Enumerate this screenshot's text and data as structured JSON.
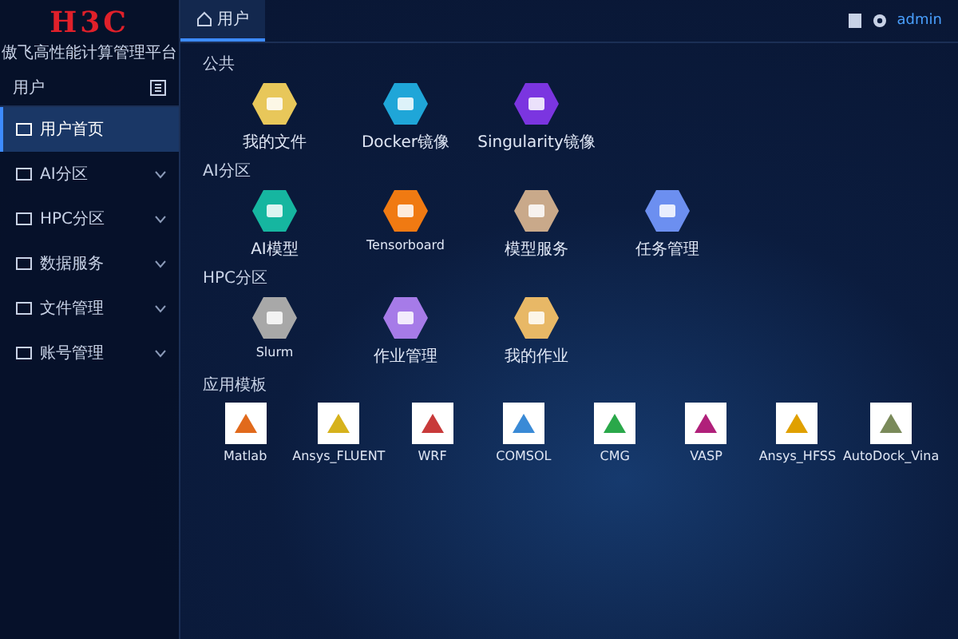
{
  "brand": {
    "logo": "H3C",
    "subtitle": "傲飞高性能计算管理平台"
  },
  "sidebar": {
    "title": "用户",
    "items": [
      {
        "label": "用户首页",
        "selected": true,
        "expandable": false
      },
      {
        "label": "AI分区",
        "selected": false,
        "expandable": true
      },
      {
        "label": "HPC分区",
        "selected": false,
        "expandable": true
      },
      {
        "label": "数据服务",
        "selected": false,
        "expandable": true
      },
      {
        "label": "文件管理",
        "selected": false,
        "expandable": true
      },
      {
        "label": "账号管理",
        "selected": false,
        "expandable": true
      }
    ]
  },
  "tabs": [
    {
      "label": "用户",
      "selected": true
    }
  ],
  "user": {
    "name": "admin"
  },
  "sections": [
    {
      "title": "公共",
      "kind": "hex",
      "apps": [
        {
          "label": "我的文件",
          "color": "#e8c75a"
        },
        {
          "label": "Docker镜像",
          "color": "#1fa6d8"
        },
        {
          "label": "Singularity镜像",
          "color": "#7b35e0"
        }
      ]
    },
    {
      "title": "AI分区",
      "kind": "hex",
      "apps": [
        {
          "label": "AI模型",
          "color": "#16b6a0"
        },
        {
          "label": "Tensorboard",
          "color": "#f07a12"
        },
        {
          "label": "模型服务",
          "color": "#c9a98a"
        },
        {
          "label": "任务管理",
          "color": "#6c8ff0"
        }
      ]
    },
    {
      "title": "HPC分区",
      "kind": "hex",
      "apps": [
        {
          "label": "Slurm",
          "color": "#a8a8a8"
        },
        {
          "label": "作业管理",
          "color": "#a67be8"
        },
        {
          "label": "我的作业",
          "color": "#e8b866"
        }
      ]
    },
    {
      "title": "应用模板",
      "kind": "logo",
      "apps": [
        {
          "label": "Matlab",
          "color": "#e16a1c"
        },
        {
          "label": "Ansys_FLUENT",
          "color": "#d6b21c"
        },
        {
          "label": "WRF",
          "color": "#c83a3a"
        },
        {
          "label": "COMSOL",
          "color": "#3a8ad6"
        },
        {
          "label": "CMG",
          "color": "#2aa84a"
        },
        {
          "label": "VASP",
          "color": "#b0207a"
        },
        {
          "label": "Ansys_HFSS",
          "color": "#e0a000"
        },
        {
          "label": "AutoDock_Vina",
          "color": "#7a8a5a"
        }
      ]
    }
  ]
}
